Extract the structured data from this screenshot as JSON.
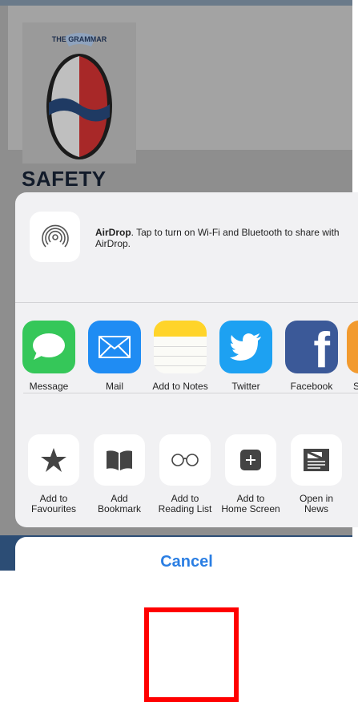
{
  "background_page": {
    "heading": "SAFETY",
    "logo_text": "THE GRAMMAR"
  },
  "share_sheet": {
    "airdrop": {
      "title": "AirDrop",
      "message": ". Tap to turn on Wi-Fi and Bluetooth to share with AirDrop.",
      "icon": "airdrop-icon"
    },
    "apps": [
      {
        "label": "Message",
        "icon": "message-icon",
        "color": "#35c759"
      },
      {
        "label": "Mail",
        "icon": "mail-icon",
        "color": "#1f8cf3"
      },
      {
        "label": "Add to Notes",
        "icon": "notes-icon",
        "color": "#ffd42a"
      },
      {
        "label": "Twitter",
        "icon": "twitter-icon",
        "color": "#1da1f2"
      },
      {
        "label": "Facebook",
        "icon": "facebook-icon",
        "color": "#3b5998"
      },
      {
        "label": "S",
        "icon": "partial-app-icon",
        "color": "#f29a2e"
      }
    ],
    "actions": [
      {
        "line1": "Add to",
        "line2": "Favourites",
        "icon": "star-icon"
      },
      {
        "line1": "Add",
        "line2": "Bookmark",
        "icon": "book-icon"
      },
      {
        "line1": "Add to",
        "line2": "Reading List",
        "icon": "glasses-icon"
      },
      {
        "line1": "Add to",
        "line2": "Home Screen",
        "icon": "plus-square-icon"
      },
      {
        "line1": "Open in",
        "line2": "News",
        "icon": "news-icon"
      }
    ],
    "cancel_label": "Cancel"
  },
  "colors": {
    "accent": "#2a7ee3",
    "highlight_box": "#ff0000"
  }
}
